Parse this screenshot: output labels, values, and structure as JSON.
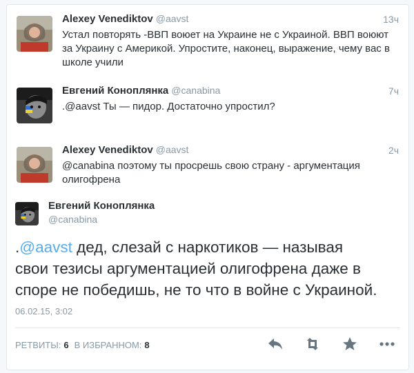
{
  "tweets": [
    {
      "name": "Alexey Venediktov",
      "handle": "@aavst",
      "time": "13ч",
      "lines": [
        "Устал повторять -ВВП воюет на Украине не с Украиной. ВВП воюют",
        "за Украину с Америкой. Упростите, наконец, выражение, чему вас в",
        "школе учили"
      ]
    },
    {
      "name": "Евгений Коноплянка",
      "handle": "@canabina",
      "time": "7ч",
      "lines": [
        ".@aavst Ты — пидор. Достаточно упростил?"
      ]
    },
    {
      "name": "Alexey Venediktov",
      "handle": "@aavst",
      "time": "2ч",
      "lines": [
        "@canabina поэтому ты просрешь свою страну - аргументация",
        "олигофрена"
      ]
    }
  ],
  "main": {
    "name": "Евгений Коноплянка",
    "handle": "@canabina",
    "text_prefix": ".",
    "mention": "@aavst",
    "text_line1_rest": " дед, слезай с наркотиков — называя",
    "text_line2": "свои тезисы аргументацией олигофрена даже в",
    "text_line3": "споре не победишь, не то что в войне с Украиной.",
    "timestamp": "06.02.15, 3:02",
    "retweets_label": "РЕТВИТЫ:",
    "retweets_count": "6",
    "favorites_label": "В ИЗБРАННОМ:",
    "favorites_count": "8"
  },
  "icons": [
    "reply-icon",
    "retweet-icon",
    "favorite-icon",
    "more-icon"
  ],
  "colors": {
    "link": "#55acee",
    "muted": "#8899a6",
    "text": "#292f33"
  }
}
